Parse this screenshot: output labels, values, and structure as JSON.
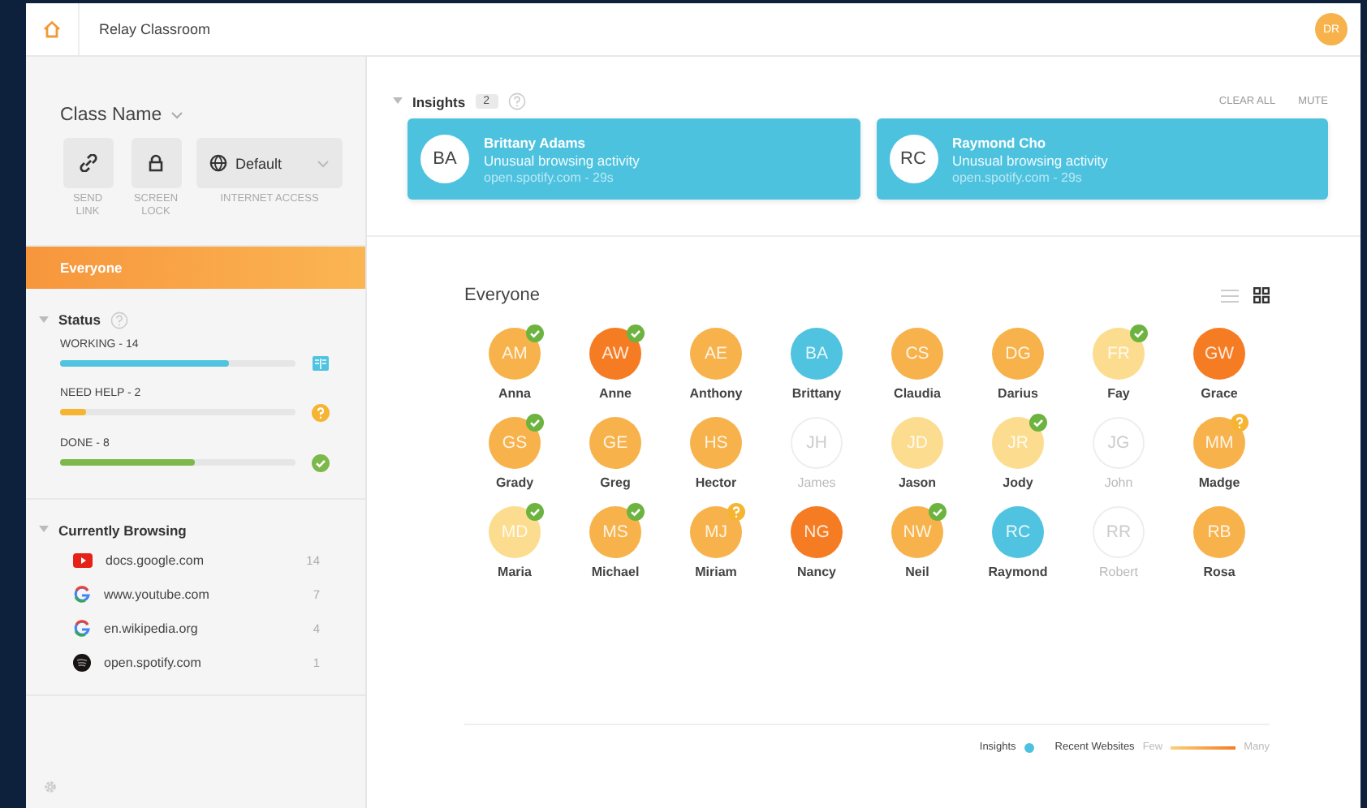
{
  "app": {
    "title": "Relay Classroom",
    "user_initials": "DR"
  },
  "sidebar": {
    "class_name": "Class Name",
    "controls": [
      {
        "kind": "link",
        "label": "SEND LINK"
      },
      {
        "kind": "lock",
        "label": "SCREEN LOCK"
      }
    ],
    "internet_access": {
      "value": "Default",
      "label": "INTERNET ACCESS"
    },
    "groups": [
      {
        "label": "Everyone",
        "selected": true
      }
    ],
    "status": {
      "title": "Status",
      "expanded": true,
      "items": [
        {
          "label": "WORKING - 14",
          "level": 0.72,
          "color": "#4fc3df",
          "kind": "working"
        },
        {
          "label": "NEED HELP - 2",
          "level": 0.11,
          "color": "#f5b431",
          "kind": "help"
        },
        {
          "label": "DONE - 8",
          "level": 0.57,
          "color": "#7cb84a",
          "kind": "done"
        }
      ]
    },
    "browsing": {
      "title": "Currently Browsing",
      "expanded": true,
      "items": [
        {
          "site": "docs.google.com",
          "count": "14",
          "kind": "youtube"
        },
        {
          "site": "www.youtube.com",
          "count": "7",
          "kind": "google"
        },
        {
          "site": "en.wikipedia.org",
          "count": "4",
          "kind": "google"
        },
        {
          "site": "open.spotify.com",
          "count": "1",
          "kind": "spotify"
        }
      ]
    }
  },
  "insights": {
    "title": "Insights",
    "count": "2",
    "expanded": true,
    "actions": [
      "CLEAR ALL",
      "MUTE"
    ],
    "cards": [
      {
        "initials": "BA",
        "name": "Brittany Adams",
        "message": "Unusual browsing activity",
        "detail": "open.spotify.com - 29s"
      },
      {
        "initials": "RC",
        "name": "Raymond Cho",
        "message": "Unusual browsing activity",
        "detail": "open.spotify.com - 29s"
      }
    ]
  },
  "roster": {
    "title": "Everyone",
    "views": [
      {
        "kind": "list",
        "selected": false
      },
      {
        "kind": "grid",
        "selected": true
      }
    ],
    "students": [
      {
        "initials": "AM",
        "name": "Anna",
        "color": "#f7b24b",
        "offline": false,
        "done": true,
        "needs_help": false
      },
      {
        "initials": "AW",
        "name": "Anne",
        "color": "#f57c23",
        "offline": false,
        "done": true,
        "needs_help": false
      },
      {
        "initials": "AE",
        "name": "Anthony",
        "color": "#f7b24b",
        "offline": false,
        "done": false,
        "needs_help": false
      },
      {
        "initials": "BA",
        "name": "Brittany",
        "color": "#4fc3df",
        "offline": false,
        "done": false,
        "needs_help": false
      },
      {
        "initials": "CS",
        "name": "Claudia",
        "color": "#f7b24b",
        "offline": false,
        "done": false,
        "needs_help": false
      },
      {
        "initials": "DG",
        "name": "Darius",
        "color": "#f7b24b",
        "offline": false,
        "done": false,
        "needs_help": false
      },
      {
        "initials": "FR",
        "name": "Fay",
        "color": "#fcdc8f",
        "offline": false,
        "done": true,
        "needs_help": false
      },
      {
        "initials": "GW",
        "name": "Grace",
        "color": "#f57c23",
        "offline": false,
        "done": false,
        "needs_help": false
      },
      {
        "initials": "GS",
        "name": "Grady",
        "color": "#f7b24b",
        "offline": false,
        "done": true,
        "needs_help": false
      },
      {
        "initials": "GE",
        "name": "Greg",
        "color": "#f7b24b",
        "offline": false,
        "done": false,
        "needs_help": false
      },
      {
        "initials": "HS",
        "name": "Hector",
        "color": "#f7b24b",
        "offline": false,
        "done": false,
        "needs_help": false
      },
      {
        "initials": "JH",
        "name": "James",
        "color": "#ffffff",
        "offline": true,
        "done": false,
        "needs_help": false
      },
      {
        "initials": "JD",
        "name": "Jason",
        "color": "#fcdc8f",
        "offline": false,
        "done": false,
        "needs_help": false
      },
      {
        "initials": "JR",
        "name": "Jody",
        "color": "#fcdc8f",
        "offline": false,
        "done": true,
        "needs_help": false
      },
      {
        "initials": "JG",
        "name": "John",
        "color": "#ffffff",
        "offline": true,
        "done": false,
        "needs_help": false
      },
      {
        "initials": "MM",
        "name": "Madge",
        "color": "#f7b24b",
        "offline": false,
        "done": false,
        "needs_help": true
      },
      {
        "initials": "MD",
        "name": "Maria",
        "color": "#fcdc8f",
        "offline": false,
        "done": true,
        "needs_help": false
      },
      {
        "initials": "MS",
        "name": "Michael",
        "color": "#f7b24b",
        "offline": false,
        "done": true,
        "needs_help": false
      },
      {
        "initials": "MJ",
        "name": "Miriam",
        "color": "#f7b24b",
        "offline": false,
        "done": false,
        "needs_help": true
      },
      {
        "initials": "NG",
        "name": "Nancy",
        "color": "#f57c23",
        "offline": false,
        "done": false,
        "needs_help": false
      },
      {
        "initials": "NW",
        "name": "Neil",
        "color": "#f7b24b",
        "offline": false,
        "done": true,
        "needs_help": false
      },
      {
        "initials": "RC",
        "name": "Raymond",
        "color": "#4fc3df",
        "offline": false,
        "done": false,
        "needs_help": false
      },
      {
        "initials": "RR",
        "name": "Robert",
        "color": "#ffffff",
        "offline": true,
        "done": false,
        "needs_help": false
      },
      {
        "initials": "RB",
        "name": "Rosa",
        "color": "#f7b24b",
        "offline": false,
        "done": false,
        "needs_help": false
      }
    ]
  },
  "legend": {
    "insights": "Insights",
    "recent": "Recent Websites",
    "low": "Few",
    "high": "Many"
  }
}
